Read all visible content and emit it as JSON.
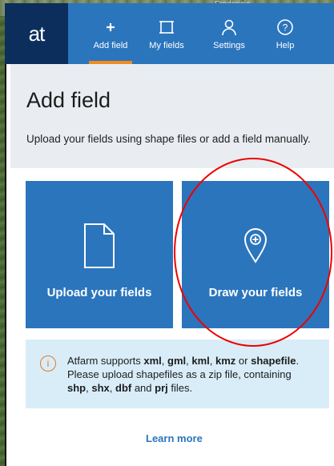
{
  "map": {
    "label": "Fredericia"
  },
  "nav": {
    "brand": "at",
    "items": [
      {
        "label": "Add field",
        "icon": "plus-icon",
        "active": true
      },
      {
        "label": "My fields",
        "icon": "square-icon",
        "active": false
      },
      {
        "label": "Settings",
        "icon": "user-icon",
        "active": false
      },
      {
        "label": "Help",
        "icon": "help-icon",
        "active": false
      }
    ]
  },
  "header": {
    "title": "Add field",
    "description": "Upload your fields using shape files or add a field manually."
  },
  "cards": {
    "upload": {
      "label": "Upload your fields",
      "icon": "document-icon"
    },
    "draw": {
      "label": "Draw your fields",
      "icon": "map-pin-plus-icon"
    }
  },
  "info": {
    "icon": "info-icon",
    "line1_prefix": "Atfarm supports ",
    "formats": [
      "xml",
      "gml",
      "kml",
      "kmz"
    ],
    "line1_or": " or ",
    "format_last": "shapefile",
    "line1_end": ".",
    "line2": "Please upload shapefiles as a zip file, containing",
    "files": [
      "shp",
      "shx",
      "dbf",
      "prj"
    ],
    "and": " and ",
    "files_end": " files."
  },
  "learn_more": "Learn more",
  "colors": {
    "primary": "#2b75bd",
    "brand_dark": "#0b2e5c",
    "accent": "#f38a1f",
    "info_bg": "#d9edf9",
    "annotation": "#e00000"
  }
}
